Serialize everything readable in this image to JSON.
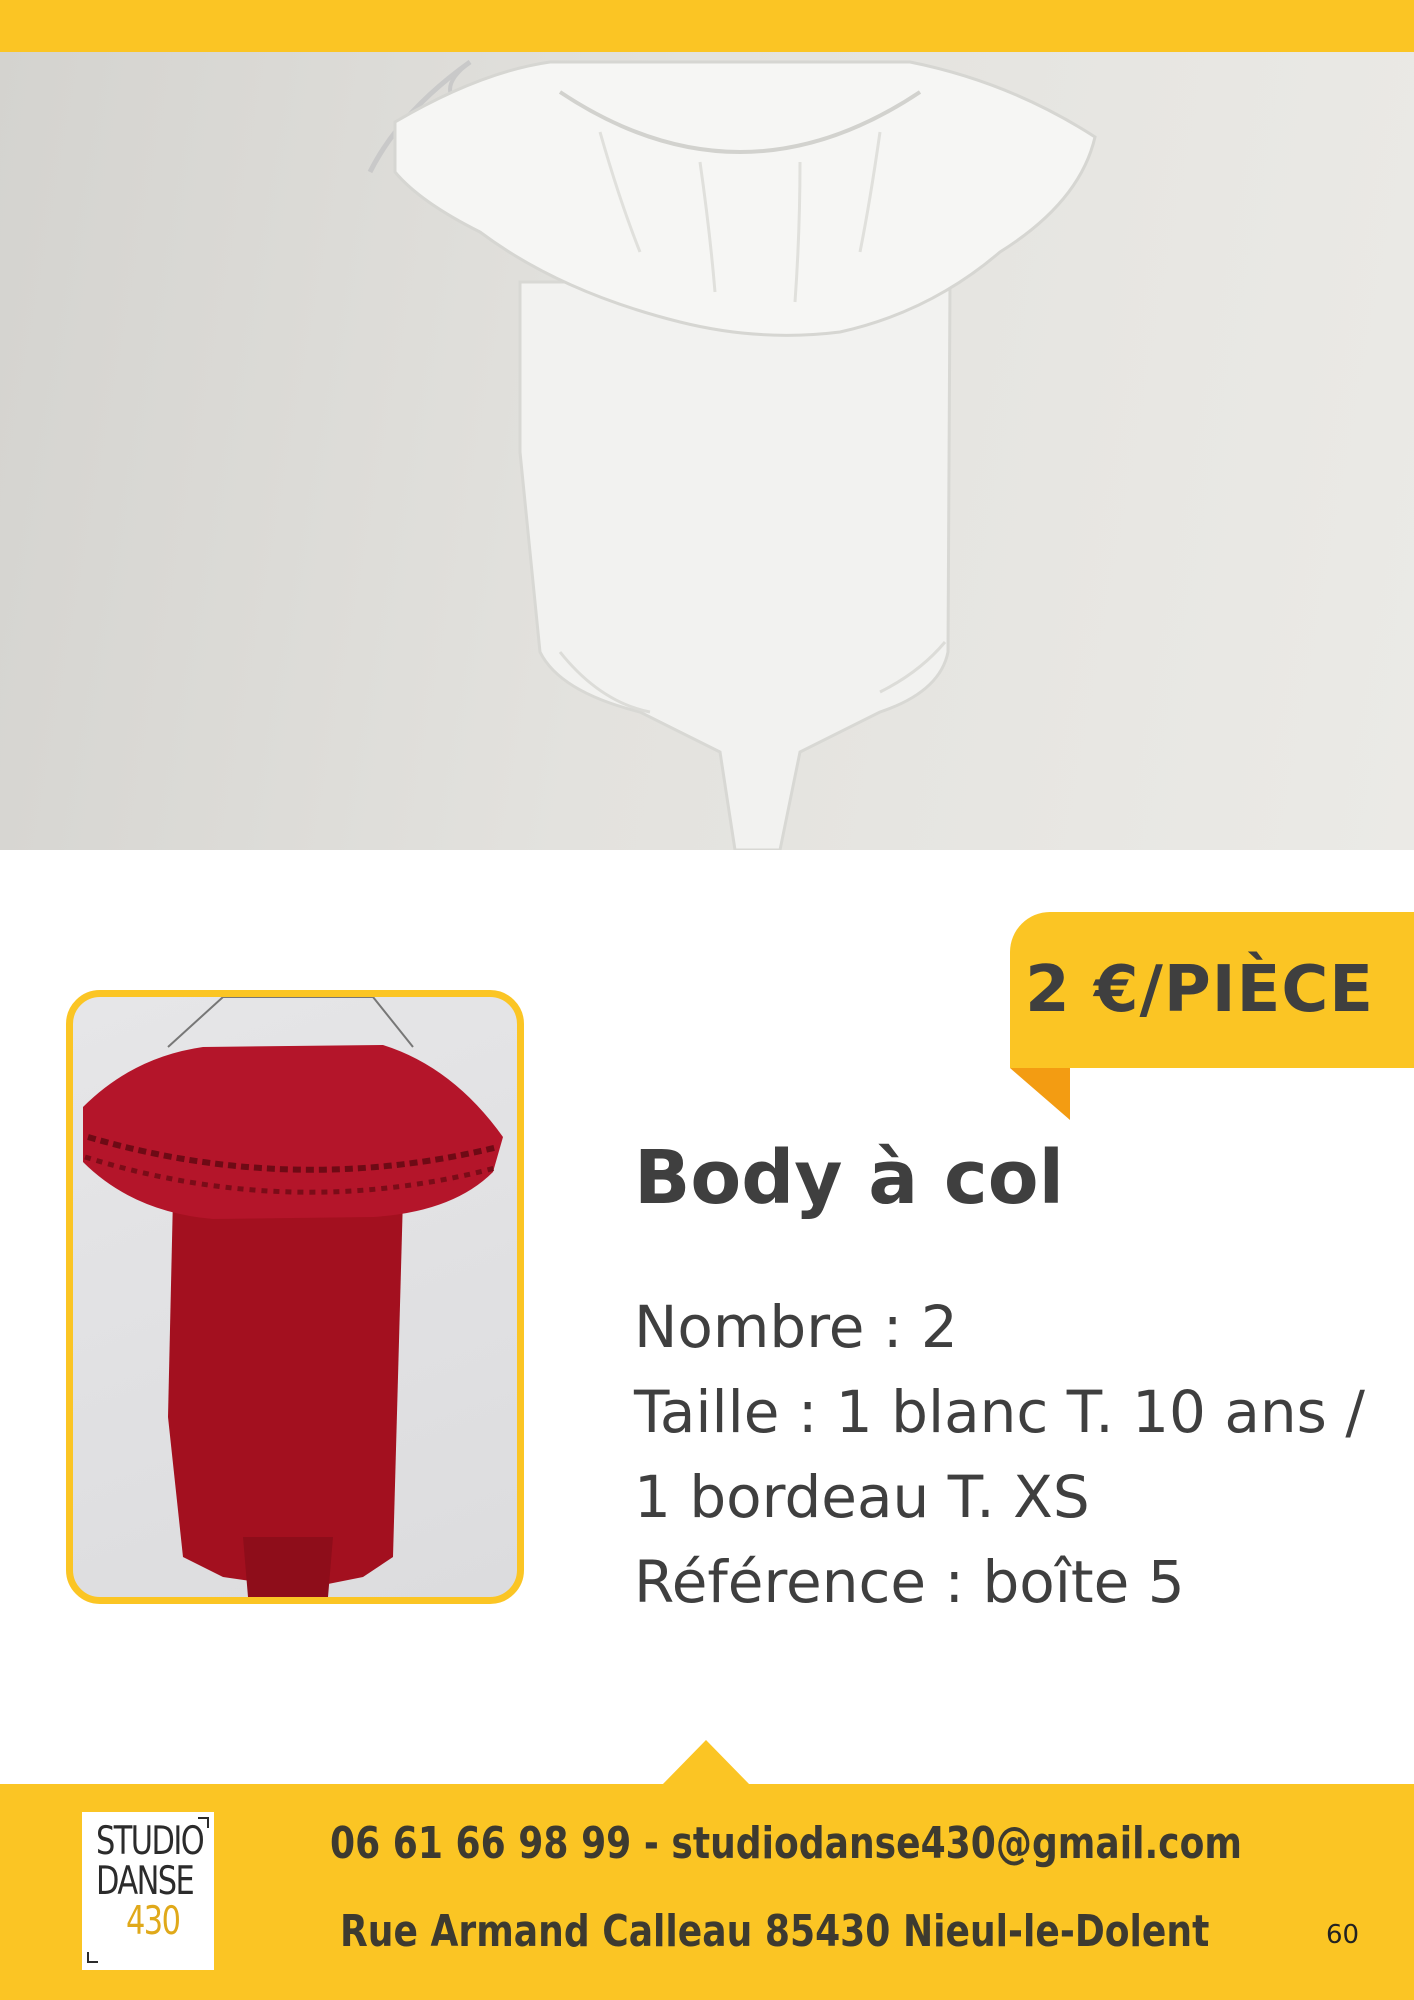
{
  "colors": {
    "accent": "#fbc524",
    "text": "#3f3f3f",
    "fold": "#f39c12"
  },
  "hero_photo": {
    "subject": "white-ruffle-bodysuit-photo"
  },
  "thumb_photo": {
    "subject": "red-lace-collar-bodysuit-photo"
  },
  "price": "2 €/PIÈCE",
  "item": {
    "title": "Body à col",
    "lines": [
      "Nombre : 2",
      "Taille : 1 blanc T. 10 ans /",
      "1 bordeau T. XS",
      "Référence : boîte 5"
    ]
  },
  "footer": {
    "logo": {
      "line1": "STUDIO",
      "line2": "DANSE",
      "line3": "430"
    },
    "contact": "06 61 66 98 99 - studiodanse430@gmail.com",
    "address": "Rue Armand Calleau 85430 Nieul-le-Dolent",
    "page_number": "60"
  }
}
